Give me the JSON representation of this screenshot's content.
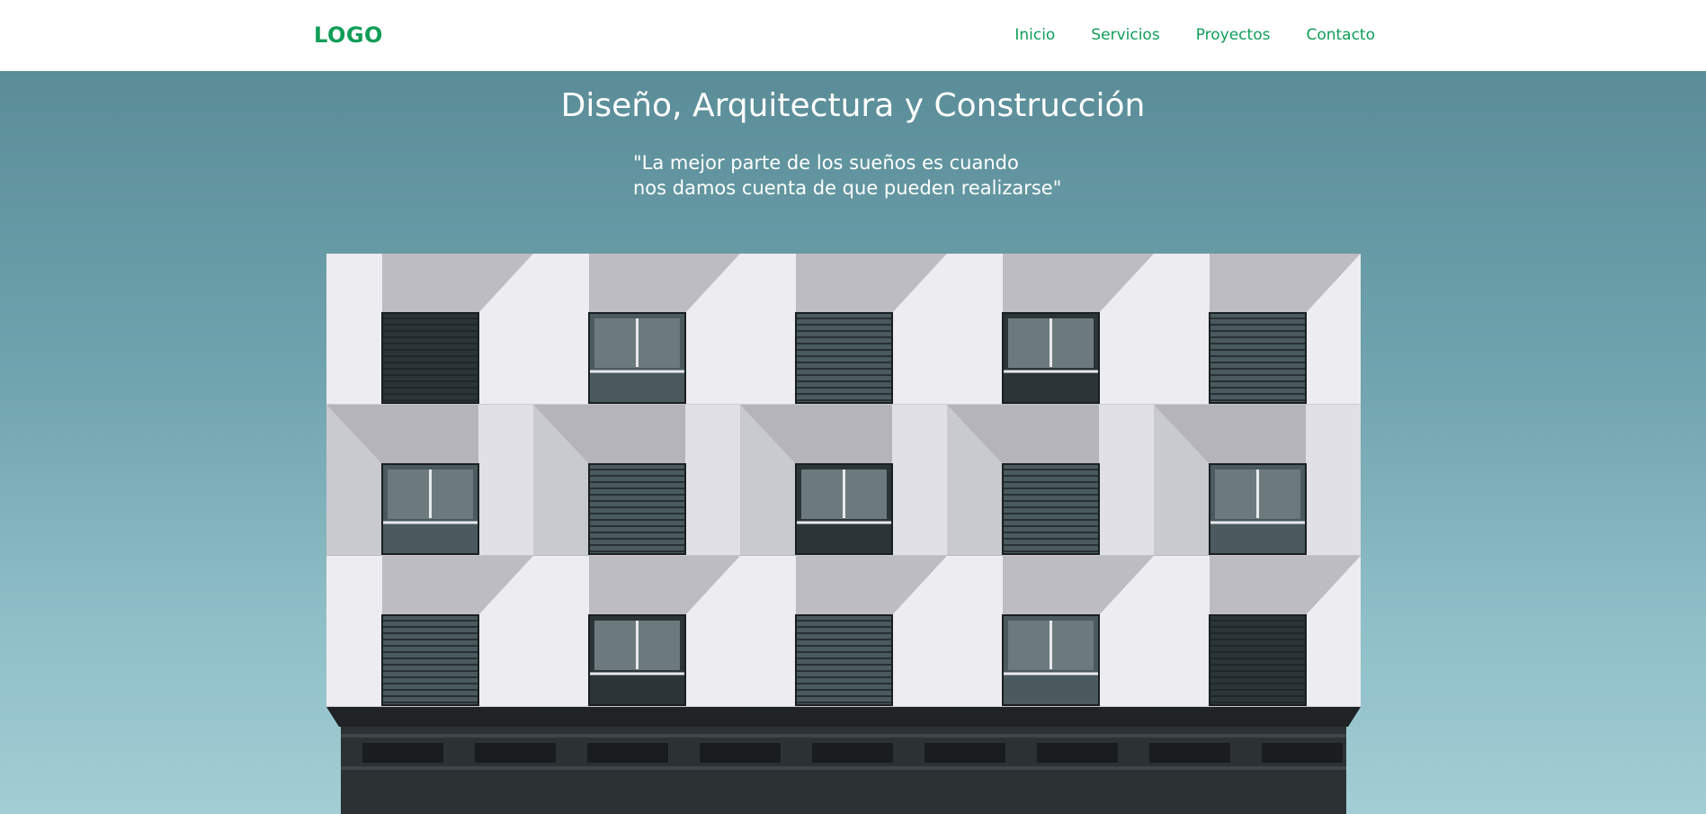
{
  "header": {
    "logo": "LOGO",
    "nav": [
      "Inicio",
      "Servicios",
      "Proyectos",
      "Contacto"
    ]
  },
  "hero": {
    "title": "Diseño, Arquitectura y Construcción",
    "quote_line1": "\"La mejor parte de los sueños es cuando",
    "quote_line2": "nos damos cuenta de que pueden realizarse\"",
    "image": "building-facade-photo"
  },
  "colors": {
    "brand": "#0f9d58",
    "hero_top": "#5a8d98",
    "hero_bottom": "#a2cdd4",
    "text_light": "#ffffff"
  }
}
